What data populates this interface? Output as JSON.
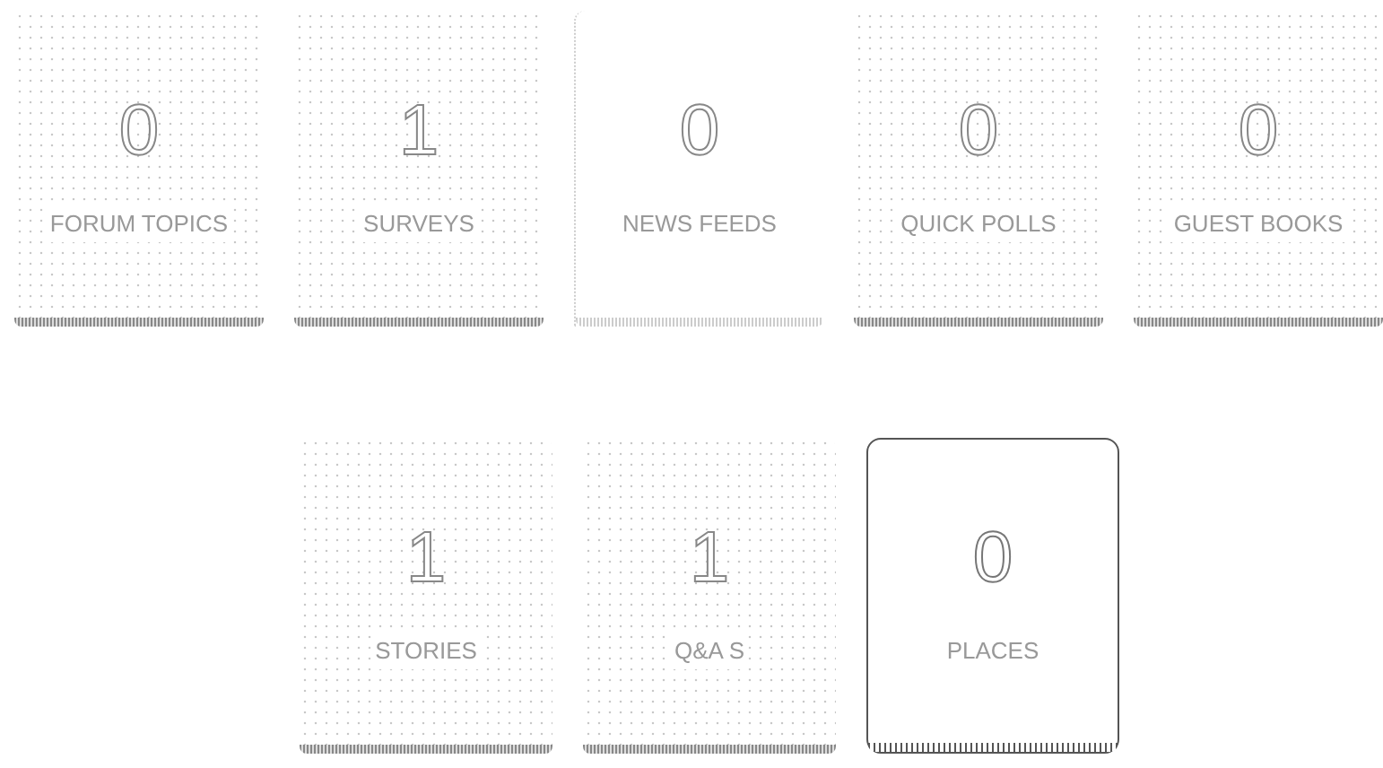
{
  "rows": [
    [
      {
        "count": "0",
        "label": "FORUM TOPICS",
        "kind": "dotted"
      },
      {
        "count": "1",
        "label": "SURVEYS",
        "kind": "dotted"
      },
      {
        "count": "0",
        "label": "NEWS FEEDS",
        "kind": "plain"
      },
      {
        "count": "0",
        "label": "QUICK POLLS",
        "kind": "dotted"
      },
      {
        "count": "0",
        "label": "GUEST BOOKS",
        "kind": "dotted"
      }
    ],
    [
      {
        "count": "1",
        "label": "STORIES",
        "kind": "dotted"
      },
      {
        "count": "1",
        "label": "Q&A S",
        "kind": "dotted"
      },
      {
        "count": "0",
        "label": "PLACES",
        "kind": "outlined"
      }
    ]
  ]
}
